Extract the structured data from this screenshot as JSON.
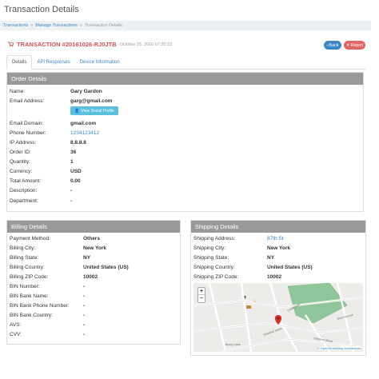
{
  "page": {
    "title": "Transaction Details"
  },
  "breadcrumb": {
    "items": [
      "Transactions",
      "Manage Transactions",
      "Transaction Details"
    ],
    "separator": "»"
  },
  "transaction": {
    "title": "TRANSACTION #20161026-RJ0JTB",
    "date": "October 26, 2016 07:20:23"
  },
  "actions": {
    "back": "Back",
    "reject": "Reject"
  },
  "tabs": [
    "Details",
    "API Responses",
    "Device Information"
  ],
  "order": {
    "heading": "Order Details",
    "social_button": "View Social Profile",
    "rows": [
      {
        "label": "Name:",
        "value": "Gary Gardon"
      },
      {
        "label": "Email Address:",
        "value": "garg@gmail.com"
      },
      {
        "label": "Email Domain:",
        "value": "gmail.com"
      },
      {
        "label": "Phone Number:",
        "value": "1234123412"
      },
      {
        "label": "IP Address:",
        "value": "8.8.8.8"
      },
      {
        "label": "Order ID:",
        "value": "36"
      },
      {
        "label": "Quantity:",
        "value": "1"
      },
      {
        "label": "Currency:",
        "value": "USD"
      },
      {
        "label": "Total Amount:",
        "value": "0.00"
      },
      {
        "label": "Description:",
        "value": "-"
      },
      {
        "label": "Department:",
        "value": "-"
      }
    ]
  },
  "billing": {
    "heading": "Billing Details",
    "rows": [
      {
        "label": "Payment Method:",
        "value": "Others"
      },
      {
        "label": "Billing City:",
        "value": "New York"
      },
      {
        "label": "Billing State:",
        "value": "NY"
      },
      {
        "label": "Billing Country:",
        "value": "United States (US)"
      },
      {
        "label": "Billing ZIP Code:",
        "value": "10002"
      },
      {
        "label": "BIN Number:",
        "value": "-"
      },
      {
        "label": "BIN Bank Name:",
        "value": "-"
      },
      {
        "label": "BIN Bank Phone Number:",
        "value": "-"
      },
      {
        "label": "BIN Bank Country:",
        "value": "-"
      },
      {
        "label": "AVS:",
        "value": "-"
      },
      {
        "label": "CVV:",
        "value": "-"
      }
    ]
  },
  "shipping": {
    "heading": "Shipping Details",
    "rows": [
      {
        "label": "Shipping Address:",
        "value": "87th St"
      },
      {
        "label": "Shipping City:",
        "value": "New York"
      },
      {
        "label": "Shipping State:",
        "value": "NY"
      },
      {
        "label": "Shipping Country:",
        "value": "United States (US)"
      },
      {
        "label": "Shipping ZIP Code:",
        "value": "10002"
      }
    ]
  },
  "map": {
    "zoom_in": "+",
    "zoom_out": "−",
    "credit": "© OpenStreetMap contributors",
    "street_labels": [
      "Cedar Lane",
      "Chestnut Street",
      "Bunny Lane",
      "Chestnut Street",
      "Birch Avenue"
    ]
  },
  "colors": {
    "link": "#3a86c8",
    "header_gray": "#999999",
    "title_red": "#d9534f",
    "reject": "#e06666",
    "back": "#3a86c8",
    "park_green": "#8fc79a"
  }
}
